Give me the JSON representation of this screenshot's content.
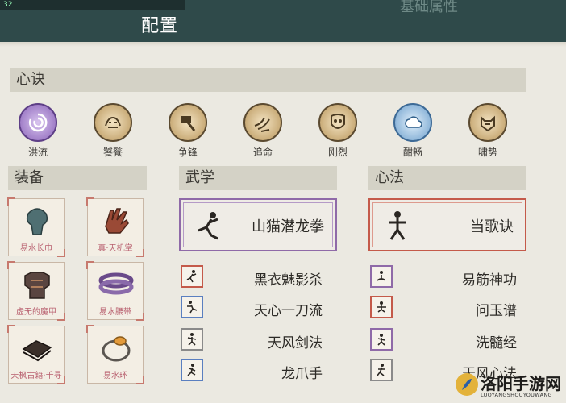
{
  "header": {
    "title": "配置",
    "prev_tab_fragment": "32",
    "ghost_title": "基础属性"
  },
  "sections": {
    "xinjue": "心诀",
    "equipment": "装备",
    "wuxue": "武学",
    "xinfa": "心法"
  },
  "xinjue_skills": [
    {
      "label": "洪流",
      "icon": "swirl-icon",
      "color": "#7b5aa6"
    },
    {
      "label": "饕餮",
      "icon": "beast-icon",
      "color": "#a88650"
    },
    {
      "label": "争锋",
      "icon": "hammer-icon",
      "color": "#a88650"
    },
    {
      "label": "追命",
      "icon": "dash-icon",
      "color": "#a88650"
    },
    {
      "label": "刚烈",
      "icon": "mask-icon",
      "color": "#a88650"
    },
    {
      "label": "酣畅",
      "icon": "cloud-icon",
      "color": "#5b8fbf"
    },
    {
      "label": "啸势",
      "icon": "tiger-icon",
      "color": "#a88650"
    }
  ],
  "equipment": [
    {
      "label": "易水长巾",
      "icon": "scarf-icon"
    },
    {
      "label": "真·天机掌",
      "icon": "glove-icon"
    },
    {
      "label": "虚无的魔甲",
      "icon": "armor-icon"
    },
    {
      "label": "易水腰带",
      "icon": "belt-icon"
    },
    {
      "label": "天枫古籍·千寻",
      "icon": "book-icon"
    },
    {
      "label": "易水环",
      "icon": "ring-icon"
    }
  ],
  "wuxue": {
    "featured": {
      "name": "山猫潜龙拳",
      "color": "#8f6aa8"
    },
    "items": [
      {
        "name": "黑衣魅影杀",
        "color": "#c45a4a"
      },
      {
        "name": "天心一刀流",
        "color": "#5a7fc0"
      },
      {
        "name": "天风剑法",
        "color": "#8a8a8a"
      },
      {
        "name": "龙爪手",
        "color": "#5a7fc0"
      }
    ]
  },
  "xinfa": {
    "featured": {
      "name": "当歌诀",
      "color": "#c45a4a"
    },
    "items": [
      {
        "name": "易筋神功",
        "color": "#8f6aa8"
      },
      {
        "name": "问玉谱",
        "color": "#c45a4a"
      },
      {
        "name": "洗髓经",
        "color": "#8f6aa8"
      },
      {
        "name": "天风心法",
        "color": "#8a8a8a"
      }
    ]
  },
  "watermark": {
    "text": "洛阳手游网",
    "url_text": "LUOYANGSHOUYOUWANG"
  }
}
